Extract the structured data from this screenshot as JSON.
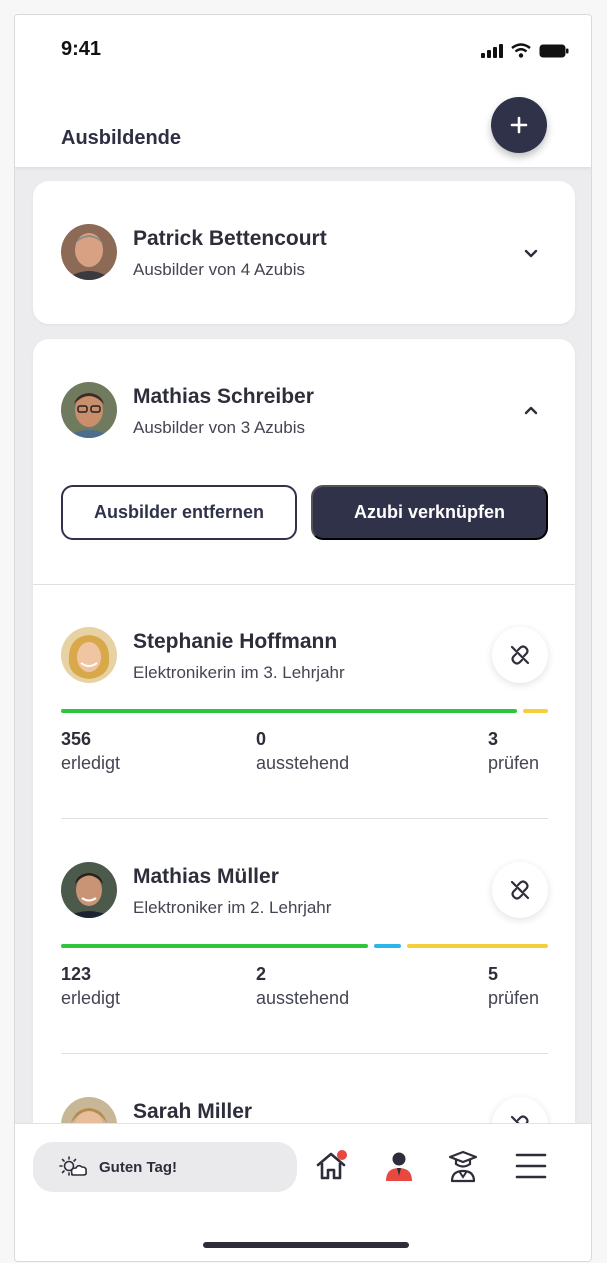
{
  "status_bar": {
    "time": "9:41"
  },
  "header": {
    "title": "Ausbildende",
    "add_icon": "plus-icon"
  },
  "trainers": [
    {
      "name": "Patrick Bettencourt",
      "subtitle": "Ausbilder von 4 Azubis",
      "expanded": false
    },
    {
      "name": "Mathias Schreiber",
      "subtitle": "Ausbilder von 3 Azubis",
      "expanded": true
    }
  ],
  "actions": {
    "remove_label": "Ausbilder entfernen",
    "link_label": "Azubi verknüpfen"
  },
  "trainees": [
    {
      "name": "Stephanie Hoffmann",
      "subtitle": "Elektronikerin im 3. Lehrjahr",
      "done": "356",
      "done_label": "erledigt",
      "pending": "0",
      "pending_label": "ausstehend",
      "review": "3",
      "review_label": "prüfen"
    },
    {
      "name": "Mathias Müller",
      "subtitle": "Elektroniker im 2. Lehrjahr",
      "done": "123",
      "done_label": "erledigt",
      "pending": "2",
      "pending_label": "ausstehend",
      "review": "5",
      "review_label": "prüfen"
    },
    {
      "name": "Sarah Miller"
    }
  ],
  "colors": {
    "done": "#2ec43b",
    "pending": "#2bb6ea",
    "review": "#f5cf3a",
    "primary": "#30324a"
  },
  "bottom_nav": {
    "greeting": "Guten Tag!",
    "icons": [
      "home-icon",
      "trainer-icon",
      "graduate-icon",
      "menu-icon"
    ]
  }
}
